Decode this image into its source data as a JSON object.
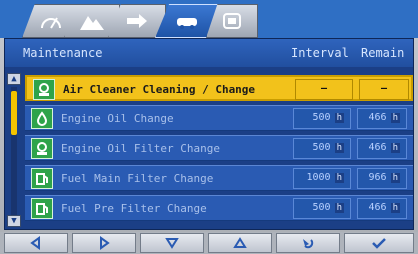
{
  "tabs": [
    {
      "name": "tab-1",
      "icon": "gauge-icon"
    },
    {
      "name": "tab-2",
      "icon": "mountain-icon"
    },
    {
      "name": "tab-3",
      "icon": "arrow-right-icon"
    },
    {
      "name": "tab-4",
      "icon": "vehicle-icon",
      "active": true
    },
    {
      "name": "tab-5",
      "icon": "monitor-icon"
    }
  ],
  "table": {
    "header_title": "Maintenance",
    "header_interval": "Interval",
    "header_remain": "Remain",
    "rows": [
      {
        "label": "Air Cleaner Cleaning / Change",
        "interval": "—",
        "remain": "—",
        "selected": true,
        "icon": "filter-icon"
      },
      {
        "label": "Engine Oil Change",
        "interval": "500",
        "remain": "466",
        "icon": "oil-icon"
      },
      {
        "label": "Engine Oil Filter Change",
        "interval": "500",
        "remain": "466",
        "icon": "filter-icon"
      },
      {
        "label": "Fuel Main Filter Change",
        "interval": "1000",
        "remain": "966",
        "icon": "fuel-icon"
      },
      {
        "label": "Fuel Pre Filter Change",
        "interval": "500",
        "remain": "466",
        "icon": "fuel-icon"
      }
    ],
    "unit": "h"
  },
  "buttons": [
    {
      "name": "left-button",
      "icon": "triangle-left-icon"
    },
    {
      "name": "right-button",
      "icon": "triangle-right-icon"
    },
    {
      "name": "down-button",
      "icon": "triangle-down-icon"
    },
    {
      "name": "up-button",
      "icon": "triangle-up-icon"
    },
    {
      "name": "back-button",
      "icon": "return-arrow-icon"
    },
    {
      "name": "ok-button",
      "icon": "check-icon"
    }
  ],
  "colors": {
    "selected": "#f2c21b",
    "screen": "#1b3f86",
    "row": "#2a5bb3"
  }
}
